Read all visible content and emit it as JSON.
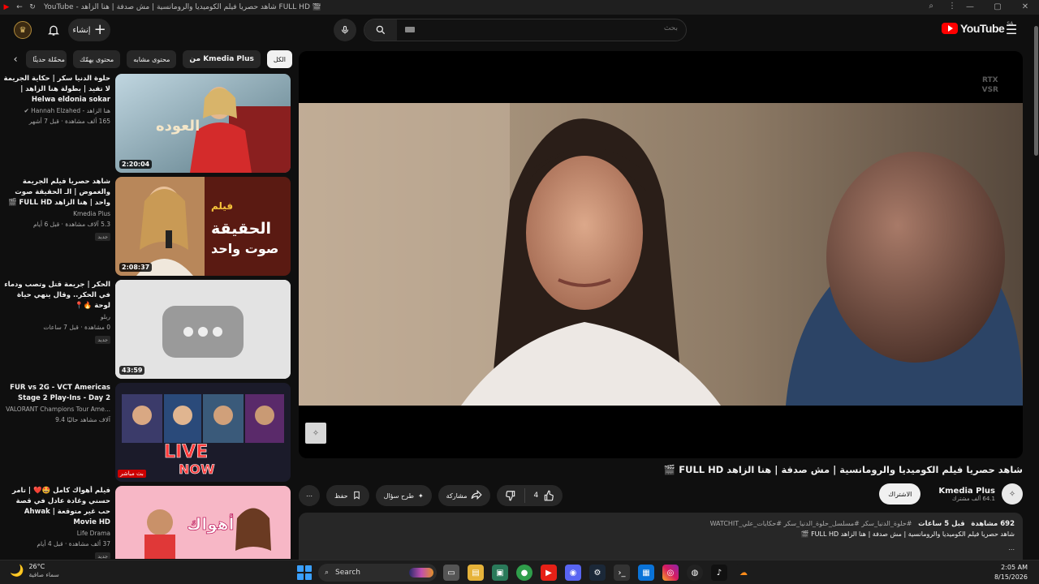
{
  "window": {
    "title": "YouTube - شاهد حصريا فيلم الكوميديا والرومانسية | مش صدفة | هنا الزاهد FULL HD 🎬",
    "controls": [
      "⌕",
      "⋮",
      "—",
      "▢",
      "✕"
    ]
  },
  "header": {
    "create_label": "إنشاء",
    "search_placeholder": "بحث",
    "logo_text": "YouTube",
    "logo_country": "SA"
  },
  "chips": [
    {
      "label": "الكل",
      "active": true
    },
    {
      "label": "من Kmedia Plus",
      "active": false
    },
    {
      "label": "محتوى مشابه",
      "active": false
    },
    {
      "label": "محتوى يهمّك",
      "active": false
    },
    {
      "label": "فيديوهات محمّلة حديثًا",
      "active": false
    }
  ],
  "recommendations": [
    {
      "title": "حلوة الدنيا سكر | حكاية الجريمة لا تفيد | بطولة هنا الزاهد | Helwa eldonia sokar",
      "channel": "هنا الزاهد - Hannah Elzahed ✔",
      "meta": "165 ألف مشاهدة · قبل 7 أشهر",
      "duration": "2:20:04",
      "badge": ""
    },
    {
      "title": "شاهد حصريا فيلم الجريمة والغموض | الـ الحقيقة صوت واحد | هنا الزاهد FULL HD 🎬",
      "channel": "Kmedia Plus",
      "meta": "5.3 آلاف مشاهدة · قبل 6 أيام",
      "duration": "2:08:37",
      "badge": "جديد"
    },
    {
      "title": "الحكر | جريمة قتل وتصب ودماء في الحكر.. وقال ينهي حياة لوحة 🔥📍",
      "channel": "ربلو",
      "meta": "0 مشاهدة · قبل 7 ساعات",
      "duration": "43:59",
      "badge": "جديد"
    },
    {
      "title": "FUR vs 2G - VCT Americas Stage 2 Play-Ins - Day 2",
      "channel": "VALORANT Champions Tour Ame...",
      "meta": "9.4 آلاف مشاهد حاليًا",
      "duration": "",
      "badge": "بث مباشر"
    },
    {
      "title": "فيلم أهواك كامل 🤩❤️ | تامر حسني وغادة عادل في قصة حب غير متوقعة | Ahwak Movie HD",
      "channel": "Life Drama",
      "meta": "37 ألف مشاهدة · قبل 4 أيام",
      "duration": "",
      "badge": "جديد"
    }
  ],
  "player": {
    "overlay_text": [
      "RTX",
      "VSR"
    ]
  },
  "video": {
    "title": "شاهد حصريا فيلم الكوميديا والرومانسية | مش صدفة | هنا الزاهد FULL HD 🎬",
    "channel_name": "Kmedia Plus",
    "subscribers": "64.1 ألف مشترك",
    "subscribe_label": "الاشتراك",
    "like_count": "4",
    "share_label": "مشاركة",
    "ask_label": "طرح سؤال",
    "save_label": "حفظ",
    "more_label": "⋯"
  },
  "description": {
    "views": "692 مشاهدة",
    "age": "قبل 5 ساعات",
    "tags": "#حلوة_الدنيا_سكر #مسلسل_حلوة_الدنيا_سكر #حكايات_علي_WATCHIT",
    "line2": "شاهد حصريا فيلم الكوميديا والرومانسية | مش صدفة | هنا الزاهد FULL HD 🎬",
    "line3": "..."
  },
  "taskbar": {
    "temperature": "26°C",
    "weather": "سماء صافية",
    "search_label": "Search",
    "time": "2:05 AM",
    "date": "8/15/2026"
  }
}
